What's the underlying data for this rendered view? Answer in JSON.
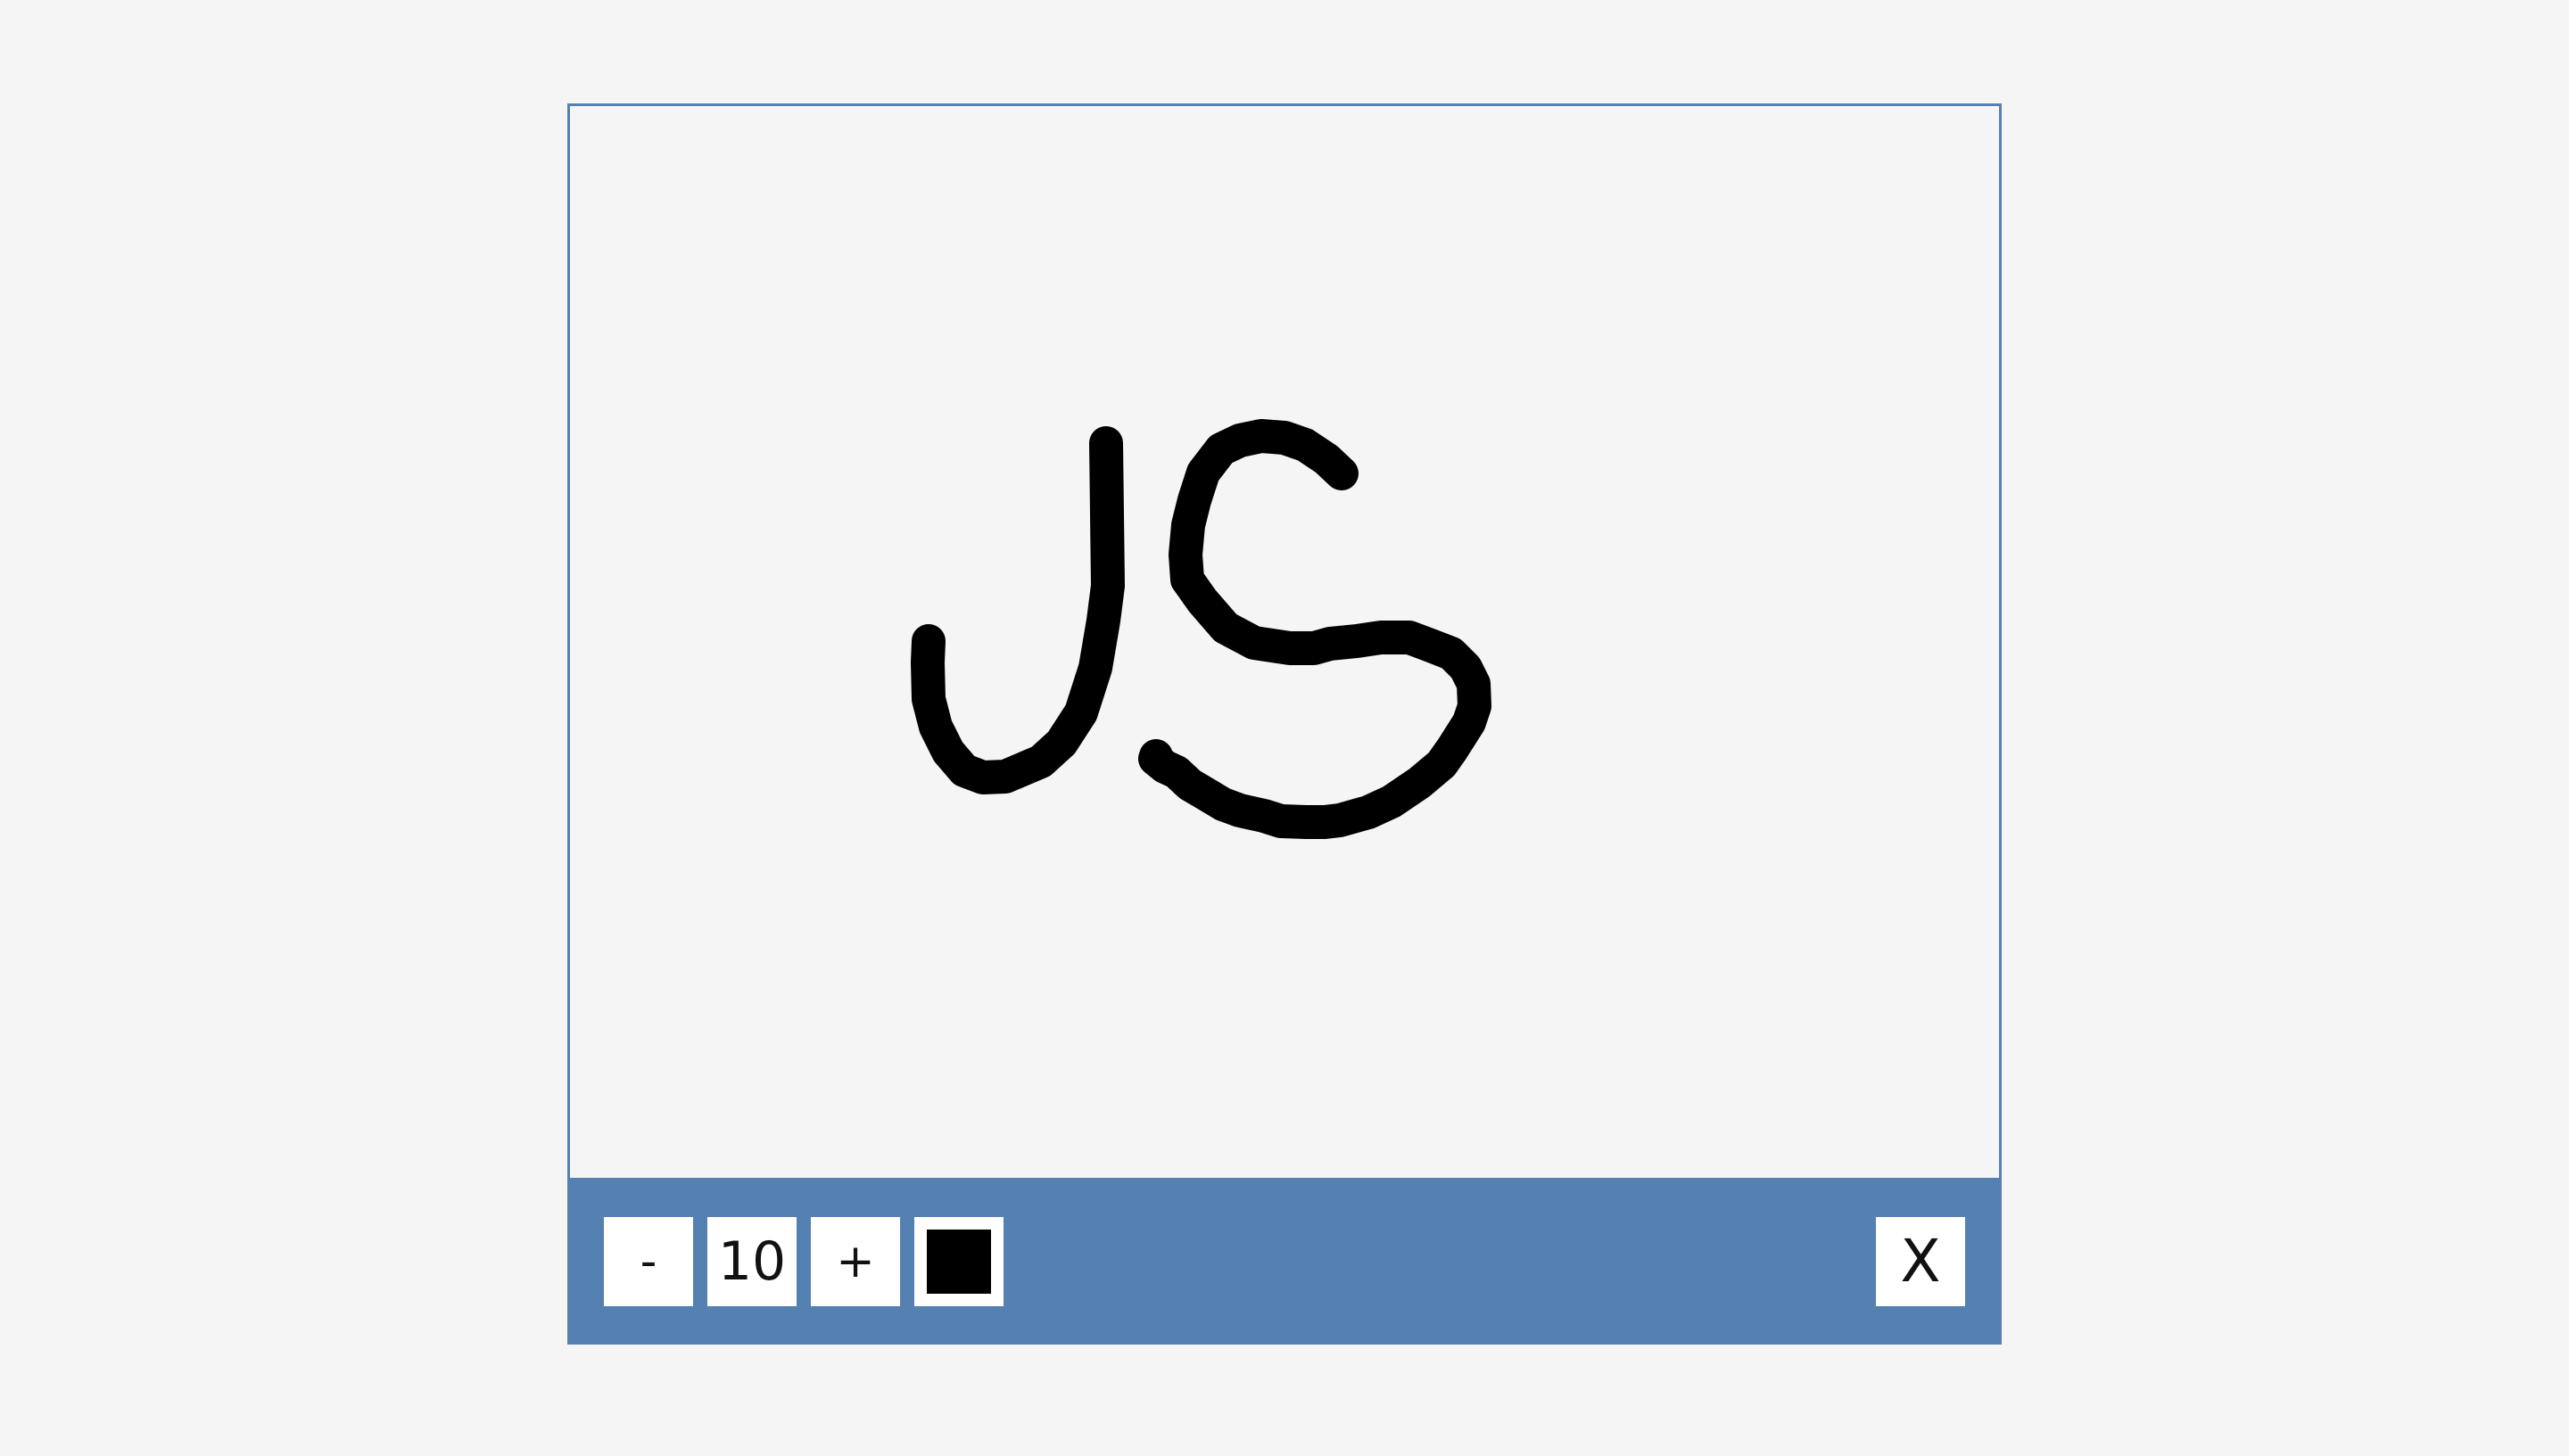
{
  "toolbar": {
    "decrease_label": "-",
    "brush_size": "10",
    "increase_label": "+",
    "brush_color": "#000000",
    "close_label": "X"
  },
  "drawing": {
    "visible_text": "JS",
    "stroke_color": "#000000"
  },
  "colors": {
    "background": "#f5f5f5",
    "accent": "#5580b2",
    "button_background": "#ffffff"
  },
  "icons": {
    "color_picker": "color-swatch-icon"
  }
}
